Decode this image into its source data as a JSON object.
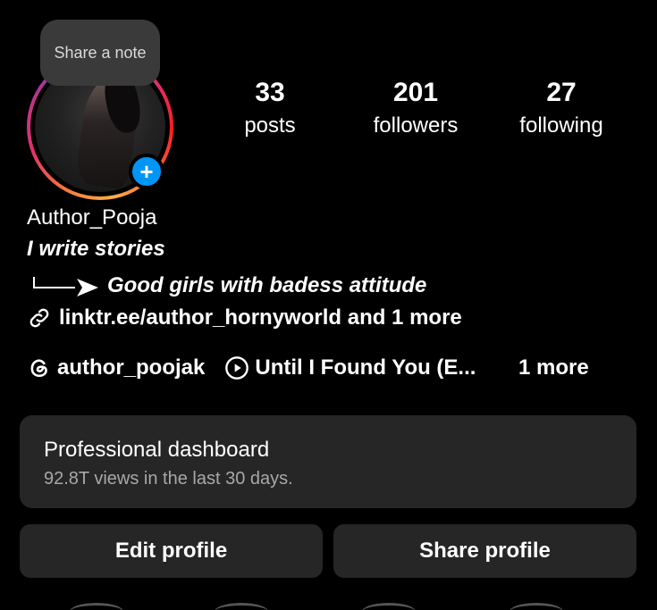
{
  "note": {
    "text": "Share a note"
  },
  "stats": {
    "posts": {
      "count": "33",
      "label": "posts"
    },
    "followers": {
      "count": "201",
      "label": "followers"
    },
    "following": {
      "count": "27",
      "label": "following"
    }
  },
  "profile": {
    "username": "Author_Pooja",
    "bio_line1": "I write stories",
    "bio_line2": "Good girls with badess attitude",
    "link_text": "linktr.ee/author_hornyworld and 1 more"
  },
  "chips": {
    "threads": "author_poojak",
    "music": "Until I Found You (E...",
    "more": "1 more"
  },
  "dashboard": {
    "title": "Professional dashboard",
    "subtitle": "92.8T views in the last 30 days."
  },
  "buttons": {
    "edit": "Edit profile",
    "share": "Share profile"
  },
  "colors": {
    "background": "#000000",
    "surface": "#262626",
    "accent_blue": "#0095f6",
    "muted_text": "#a8a8a8"
  }
}
